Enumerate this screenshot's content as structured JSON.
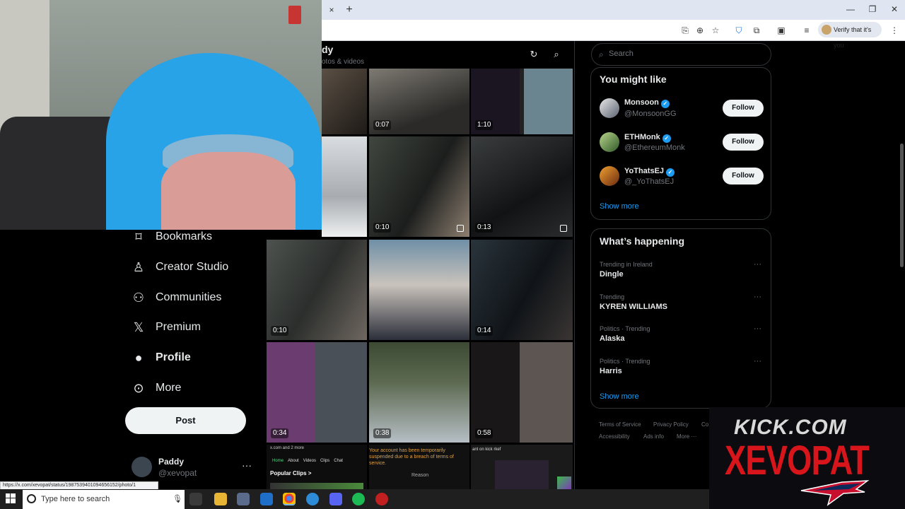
{
  "browser": {
    "tab_close": "×",
    "tab_new": "+",
    "verify_chip": "Verify that it's you",
    "status_url": "https://x.com/xevopat/status/1987539401094656152/photo/1"
  },
  "profile_header": {
    "name": "dy",
    "subtitle": "otos & videos"
  },
  "leftnav": {
    "items": [
      {
        "label": "Bookmarks",
        "icon": "bookmark-icon"
      },
      {
        "label": "Creator Studio",
        "icon": "creator-studio-icon"
      },
      {
        "label": "Communities",
        "icon": "communities-icon"
      },
      {
        "label": "Premium",
        "icon": "x-logo-icon"
      },
      {
        "label": "Profile",
        "icon": "person-icon"
      },
      {
        "label": "More",
        "icon": "more-circle-icon"
      }
    ],
    "post_label": "Post",
    "account": {
      "name": "Paddy",
      "handle": "@xevopat",
      "more": "···"
    }
  },
  "media_grid": {
    "durations": [
      "0:07",
      "1:10",
      "0:10",
      "0:13",
      "0:10",
      "0:14",
      "0:34",
      "0:38",
      "0:58"
    ],
    "tile_texts": {
      "source": "x.com and 2 more",
      "tabs": [
        "Home",
        "About",
        "Videos",
        "Clips",
        "Chat"
      ],
      "popular_clips": "Popular Clips  >",
      "suspended": "Your account has been temporarily suspended due to a breach of terms of service.",
      "reason": "Reason",
      "kick_chat": "ant on kick rkef"
    }
  },
  "search": {
    "placeholder": "Search"
  },
  "who_to_follow": {
    "title": "You might like",
    "users": [
      {
        "name": "Monsoon",
        "handle": "@MonsoonGG",
        "button": "Follow"
      },
      {
        "name": "ETHMonk",
        "handle": "@EthereumMonk",
        "button": "Follow"
      },
      {
        "name": "YoThatsEJ",
        "handle": "@_YoThatsEJ",
        "button": "Follow"
      }
    ],
    "show_more": "Show more"
  },
  "trends": {
    "title": "What’s happening",
    "items": [
      {
        "meta": "Trending in Ireland",
        "name": "Dingle"
      },
      {
        "meta": "Trending",
        "name": "KYREN WILLIAMS"
      },
      {
        "meta": "Politics · Trending",
        "name": "Alaska"
      },
      {
        "meta": "Politics · Trending",
        "name": "Harris"
      }
    ],
    "show_more": "Show more"
  },
  "footer": {
    "links": [
      "Terms of Service",
      "Privacy Policy",
      "Co",
      "Accessibility",
      "Ads info",
      "More ···"
    ]
  },
  "overlay": {
    "line1": "KICK.COM",
    "line2": "XEVOPAT"
  },
  "taskbar": {
    "search_text": "Type here to search"
  },
  "colors": {
    "accent": "#1d9bf0",
    "kick_red": "#d8151b",
    "background": "#000000"
  }
}
